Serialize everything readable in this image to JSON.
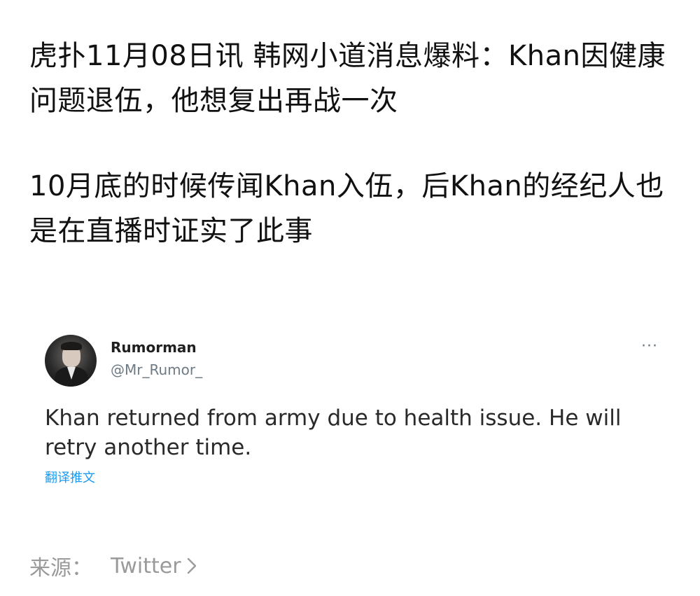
{
  "article": {
    "paragraph_1": "虎扑11月08日讯 韩网小道消息爆料：Khan因健康问题退伍，他想复出再战一次",
    "paragraph_2": "10月底的时候传闻Khan入伍，后Khan的经纪人也是在直播时证实了此事"
  },
  "tweet": {
    "display_name": "Rumorman",
    "handle": "@Mr_Rumor_",
    "more_label": "···",
    "text": "Khan returned from army due to health issue. He will retry another time.",
    "translate_label": "翻译推文"
  },
  "source": {
    "label": "来源：",
    "name": "Twitter"
  },
  "colors": {
    "link_blue": "#1d9bf0",
    "muted_gray": "#9a9a9a",
    "handle_gray": "#6e7b85"
  },
  "icons": {
    "more": "more-horizontal-icon",
    "chevron": "chevron-right-icon"
  }
}
